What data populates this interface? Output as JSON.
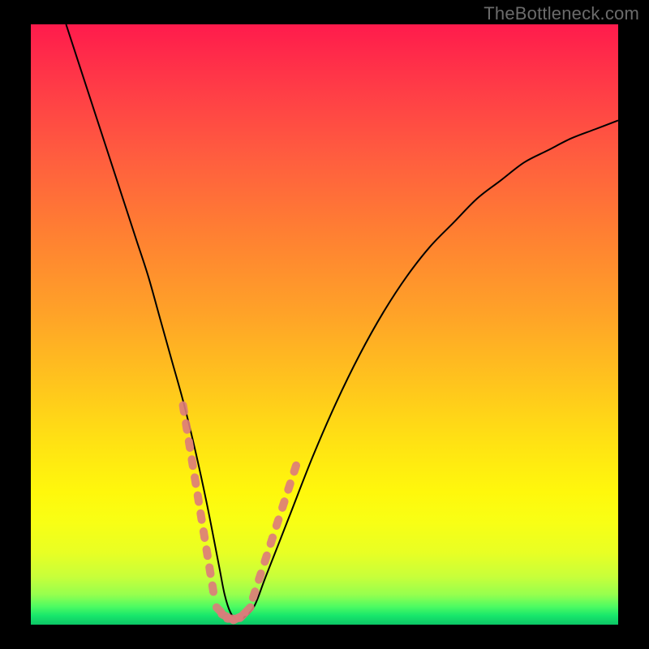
{
  "watermark": "TheBottleneck.com",
  "chart_data": {
    "type": "line",
    "title": "",
    "xlabel": "",
    "ylabel": "",
    "xlim": [
      0,
      100
    ],
    "ylim": [
      0,
      100
    ],
    "grid": false,
    "series": [
      {
        "name": "bottleneck-curve",
        "color": "#000000",
        "x": [
          6,
          8,
          10,
          12,
          14,
          16,
          18,
          20,
          22,
          24,
          26,
          28,
          30,
          32,
          33,
          34,
          35,
          36,
          38,
          40,
          44,
          48,
          52,
          56,
          60,
          64,
          68,
          72,
          76,
          80,
          84,
          88,
          92,
          96,
          100
        ],
        "y": [
          100,
          94,
          88,
          82,
          76,
          70,
          64,
          58,
          51,
          44,
          37,
          29,
          20,
          10,
          5,
          2,
          1,
          1,
          3,
          8,
          18,
          28,
          37,
          45,
          52,
          58,
          63,
          67,
          71,
          74,
          77,
          79,
          81,
          82.5,
          84
        ]
      },
      {
        "name": "highlight-dots-left",
        "color": "#dd7b7b",
        "x": [
          26,
          26.5,
          27,
          27.5,
          28,
          28.5,
          29,
          29.5,
          30,
          30.5,
          31
        ],
        "y": [
          36,
          33,
          30,
          27,
          24,
          21,
          18,
          15,
          12,
          9,
          6
        ]
      },
      {
        "name": "highlight-dots-bottom",
        "color": "#dd7b7b",
        "x": [
          32,
          33,
          34,
          35,
          36,
          37
        ],
        "y": [
          2.5,
          1.5,
          1,
          1,
          1.5,
          2.5
        ]
      },
      {
        "name": "highlight-dots-right",
        "color": "#dd7b7b",
        "x": [
          38,
          39,
          40,
          41,
          42,
          43,
          44,
          45
        ],
        "y": [
          5,
          8,
          11,
          14,
          17,
          20,
          23,
          26
        ]
      }
    ]
  }
}
